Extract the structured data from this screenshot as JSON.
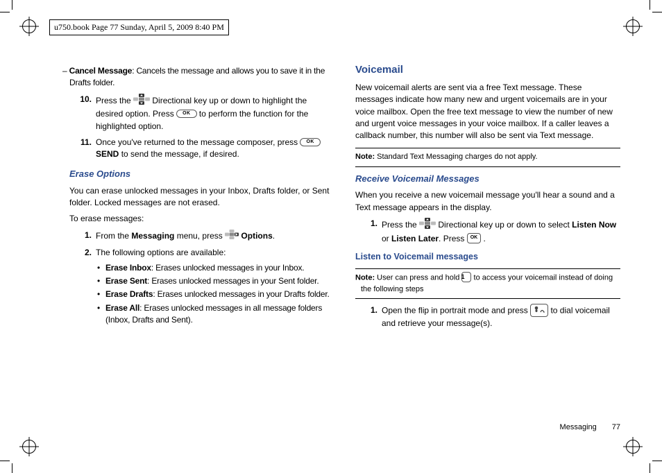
{
  "header": {
    "running": "u750.book  Page 77  Sunday, April 5, 2009  8:40 PM"
  },
  "left": {
    "cancel_msg_label": "Cancel Message",
    "cancel_msg_desc": ": Cancels the message and allows you to save it in the Drafts folder.",
    "step10_num": "10.",
    "step10_a": "Press the ",
    "step10_b": " Directional key up or down to highlight the desired option. Press ",
    "step10_c": " to perform the function for the highlighted option.",
    "step11_num": "11.",
    "step11_a": "Once you've returned to the message composer, press ",
    "step11_send": "SEND",
    "step11_b": " to send the message, if desired.",
    "erase_hd": "Erase Options",
    "erase_p1": "You can erase unlocked messages in your Inbox, Drafts folder, or Sent folder. Locked messages are not erased.",
    "erase_p2": "To erase messages:",
    "e1_num": "1.",
    "e1_a": "From the ",
    "e1_menu": "Messaging",
    "e1_b": " menu, press ",
    "e1_opts": "Options",
    "e1_c": ".",
    "e2_num": "2.",
    "e2_a": "The following options are available:",
    "bul1_label": "Erase Inbox",
    "bul1_desc": ": Erases unlocked messages in your Inbox.",
    "bul2_label": "Erase Sent",
    "bul2_desc": ": Erases unlocked messages in your Sent folder.",
    "bul3_label": "Erase Drafts",
    "bul3_desc": ": Erases unlocked messages in your Drafts folder.",
    "bul4_label": "Erase All",
    "bul4_desc": ": Erases unlocked messages in all message folders (Inbox, Drafts and Sent)."
  },
  "right": {
    "vm_hd": "Voicemail",
    "vm_p1": "New voicemail alerts are sent via a free Text message. These messages indicate how many new and urgent voicemails are in your voice mailbox. Open the free text message to view the number of new and urgent voice messages in your voice mailbox. If a caller leaves a callback number, this number will also be sent via Text message.",
    "note1_label": "Note:",
    "note1_text": " Standard Text Messaging charges do not apply.",
    "recv_hd": "Receive Voicemail Messages",
    "recv_p1": "When you receive a new voicemail message you'll hear a sound and a Text message appears in the display.",
    "r1_num": "1.",
    "r1_a": "Press the ",
    "r1_b": " Directional key up or down to select ",
    "r1_now": "Listen Now",
    "r1_or": " or ",
    "r1_later": "Listen Later",
    "r1_c": ". Press  ",
    "r1_d": " .",
    "listen_hd": "Listen to Voicemail messages",
    "note2_label": "Note:",
    "note2_a": " User can press and hold ",
    "note2_b": " to access your voicemail instead of doing the following steps",
    "l1_num": "1.",
    "l1_a": "Open the flip in portrait mode and press ",
    "l1_b": " to dial voicemail and retrieve your message(s)."
  },
  "footer": {
    "section": "Messaging",
    "page": "77"
  }
}
